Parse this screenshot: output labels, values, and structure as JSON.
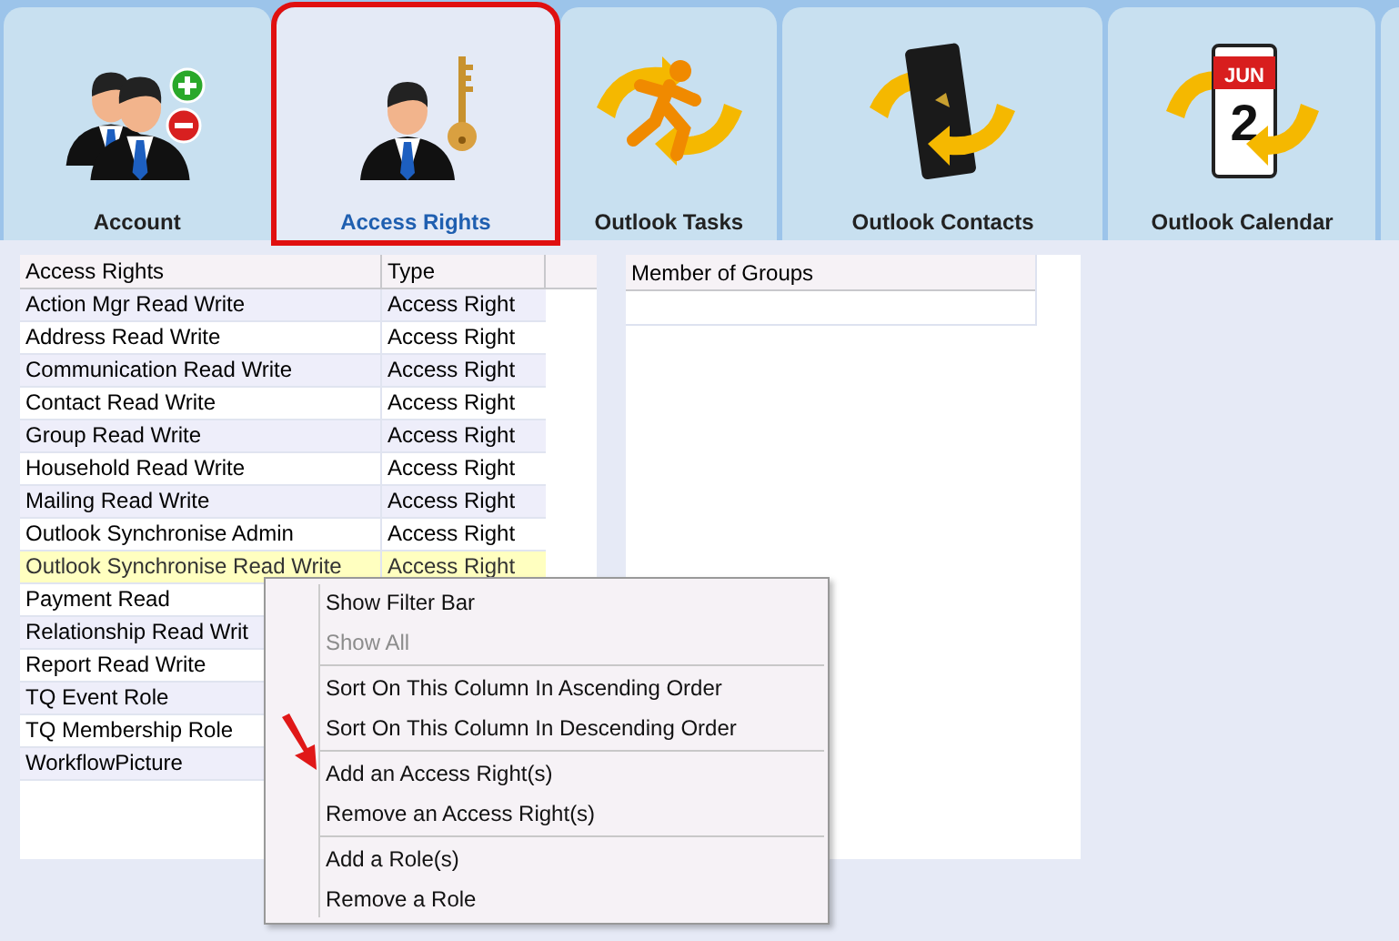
{
  "toolbar": [
    {
      "label": "Account",
      "kind": "people",
      "selected": false
    },
    {
      "label": "Access Rights",
      "kind": "key",
      "selected": true
    },
    {
      "label": "Outlook Tasks",
      "kind": "runner",
      "selected": false
    },
    {
      "label": "Outlook Contacts",
      "kind": "book",
      "selected": false
    },
    {
      "label": "Outlook Calendar",
      "kind": "calendar",
      "selected": false,
      "icon_text": "JUN",
      "icon_number": "2"
    }
  ],
  "access_table": {
    "columns": [
      "Access Rights",
      "Type"
    ],
    "rows": [
      {
        "name": "Action Mgr Read Write",
        "type": "Access Right",
        "selected": false
      },
      {
        "name": "Address Read Write",
        "type": "Access Right",
        "selected": false
      },
      {
        "name": "Communication Read Write",
        "type": "Access Right",
        "selected": false
      },
      {
        "name": "Contact Read Write",
        "type": "Access Right",
        "selected": false
      },
      {
        "name": "Group Read Write",
        "type": "Access Right",
        "selected": false
      },
      {
        "name": "Household Read Write",
        "type": "Access Right",
        "selected": false
      },
      {
        "name": "Mailing Read Write",
        "type": "Access Right",
        "selected": false
      },
      {
        "name": "Outlook Synchronise Admin",
        "type": "Access Right",
        "selected": false
      },
      {
        "name": "Outlook Synchronise Read Write",
        "type": "Access Right",
        "selected": true
      },
      {
        "name": "Payment Read",
        "selected": false
      },
      {
        "name": "Relationship Read Writ",
        "selected": false
      },
      {
        "name": "Report Read Write",
        "selected": false
      },
      {
        "name": "TQ Event Role",
        "selected": false
      },
      {
        "name": "TQ Membership Role",
        "selected": false
      },
      {
        "name": "WorkflowPicture",
        "selected": false
      }
    ]
  },
  "groups_table": {
    "columns": [
      "Member of Groups"
    ]
  },
  "context_menu": [
    {
      "kind": "item",
      "label": "Show Filter Bar",
      "disabled": false
    },
    {
      "kind": "item",
      "label": "Show All",
      "disabled": true
    },
    {
      "kind": "separator"
    },
    {
      "kind": "item",
      "label": "Sort On This Column In Ascending Order",
      "disabled": false
    },
    {
      "kind": "item",
      "label": "Sort On This Column In Descending Order",
      "disabled": false
    },
    {
      "kind": "separator"
    },
    {
      "kind": "item",
      "label": "Add an Access Right(s)",
      "disabled": false
    },
    {
      "kind": "item",
      "label": "Remove an Access Right(s)",
      "disabled": false
    },
    {
      "kind": "separator"
    },
    {
      "kind": "item",
      "label": "Add a Role(s)",
      "disabled": false
    },
    {
      "kind": "item",
      "label": "Remove a Role",
      "disabled": false
    }
  ]
}
